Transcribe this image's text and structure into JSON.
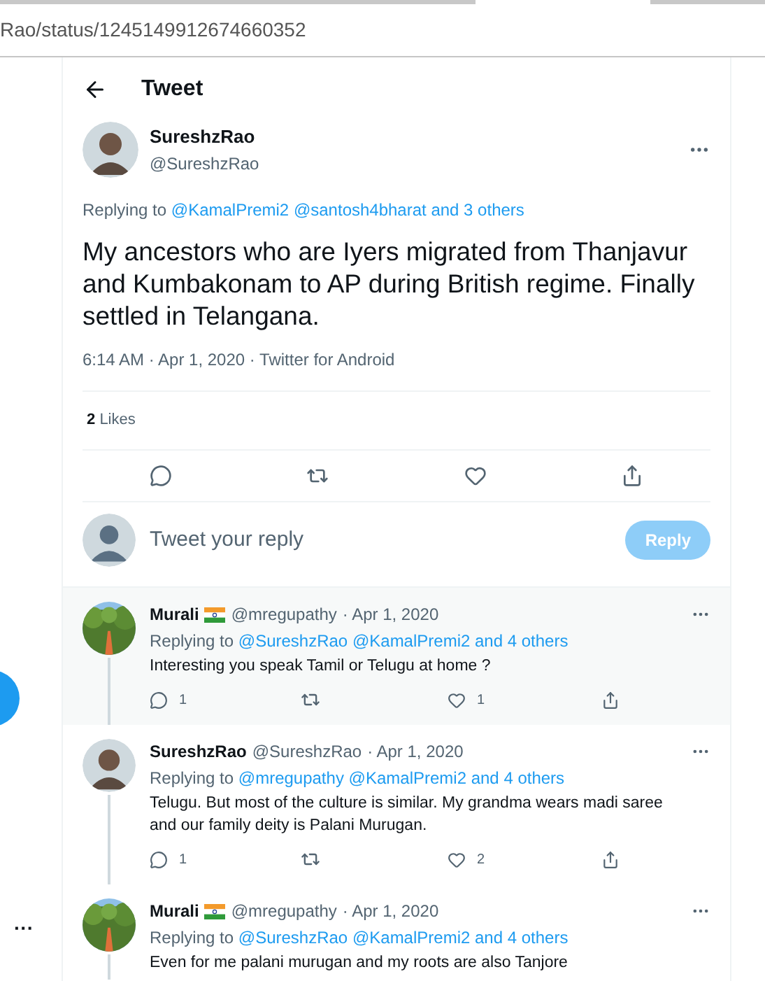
{
  "address_bar": {
    "url": "Rao/status/1245149912674660352"
  },
  "header": {
    "title": "Tweet"
  },
  "tweet": {
    "avatar": {
      "kind": "person"
    },
    "name": "SureshzRao",
    "handle": "@SureshzRao",
    "replying_prefix": "Replying to",
    "replying_links": [
      "@KamalPremi2",
      "@santosh4bharat and 3 others"
    ],
    "text": "My ancestors who are Iyers migrated from Thanjavur and Kumbakonam to AP during British regime. Finally settled in Telangana.",
    "meta": "6:14 AM · Apr 1, 2020 · Twitter for Android",
    "likes_count": "2",
    "likes_label": "Likes"
  },
  "reply_box": {
    "placeholder": "Tweet your reply",
    "button": "Reply",
    "disabled": true
  },
  "replies": [
    {
      "avatar": {
        "kind": "picture"
      },
      "name": "Murali",
      "flag": true,
      "handle": "@mregupathy",
      "date": "· Apr 1, 2020",
      "replying_prefix": "Replying to",
      "replying_links": [
        "@SureshzRao",
        "@KamalPremi2 and 4 others"
      ],
      "text": "Interesting you speak Tamil or Telugu at home ?",
      "reply_count": "1",
      "like_count": "1",
      "highlighted": true
    },
    {
      "avatar": {
        "kind": "person"
      },
      "name": "SureshzRao",
      "flag": false,
      "handle": "@SureshzRao",
      "date": "· Apr 1, 2020",
      "replying_prefix": "Replying to",
      "replying_links": [
        "@mregupathy",
        "@KamalPremi2 and 4 others"
      ],
      "text": "Telugu. But most of the culture is similar. My grandma wears madi saree and our family deity is Palani Murugan.",
      "reply_count": "1",
      "like_count": "2",
      "highlighted": false
    },
    {
      "avatar": {
        "kind": "picture"
      },
      "name": "Murali",
      "flag": true,
      "handle": "@mregupathy",
      "date": "· Apr 1, 2020",
      "replying_prefix": "Replying to",
      "replying_links": [
        "@SureshzRao",
        "@KamalPremi2 and 4 others"
      ],
      "text": "Even for me palani murugan and my roots are also Tanjore",
      "highlighted": false
    }
  ],
  "side_more": "···"
}
